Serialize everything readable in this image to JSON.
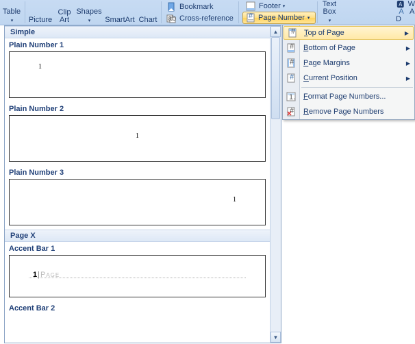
{
  "ribbon": {
    "table": "Table",
    "picture": "Picture",
    "clipart_l1": "Clip",
    "clipart_l2": "Art",
    "shapes": "Shapes",
    "smartart": "SmartArt",
    "chart": "Chart",
    "bookmark": "Bookmark",
    "crossref": "Cross-reference",
    "footer": "Footer",
    "pagenum": "Page Number",
    "textbox_l1": "Text",
    "textbox_l2": "Box",
    "far_w": "W",
    "far_a": "A",
    "far_d": "D"
  },
  "menu": {
    "top": "op of Page",
    "top_prefix": "T",
    "bottom": "ottom of Page",
    "bottom_prefix": "B",
    "margins": "age Margins",
    "margins_prefix": "P",
    "current": "urrent Position",
    "current_prefix": "C",
    "format": "ormat Page Numbers...",
    "format_prefix": "F",
    "remove": "emove Page Numbers",
    "remove_prefix": "R"
  },
  "gallery": {
    "simple_header": "Simple",
    "pn1": "Plain Number 1",
    "pn2": "Plain Number 2",
    "pn3": "Plain Number 3",
    "pagex_header": "Page X",
    "ab1": "Accent Bar 1",
    "ab2": "Accent Bar 2",
    "sample_num": "1",
    "accent_num": "1",
    "accent_word": "Page"
  }
}
